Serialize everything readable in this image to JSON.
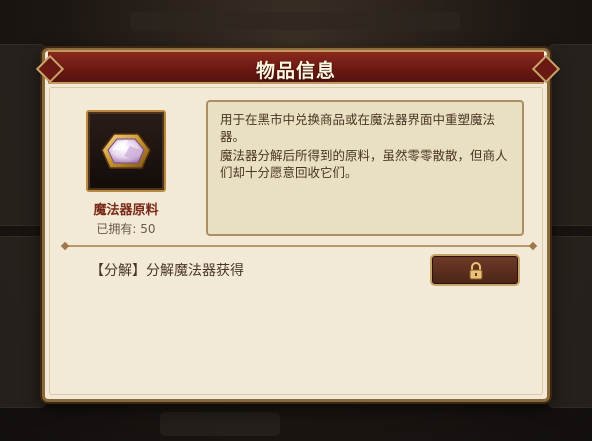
{
  "dialog": {
    "title": "物品信息"
  },
  "item": {
    "name": "魔法器原料",
    "owned_label": "已拥有: 50",
    "icon": "hexagon-crystal-icon"
  },
  "description": {
    "line1": "用于在黑市中兑换商品或在魔法器界面中重塑魔法器。",
    "line2": "魔法器分解后所得到的原料，虽然零零散散，但商人们却十分愿意回收它们。"
  },
  "source": {
    "text": "【分解】分解魔法器获得",
    "button_icon": "lock-icon"
  },
  "colors": {
    "title_bar": "#6a1812",
    "panel_bg": "#f2ead6",
    "accent_gold": "#c9a46a",
    "item_name": "#7a2a18"
  }
}
